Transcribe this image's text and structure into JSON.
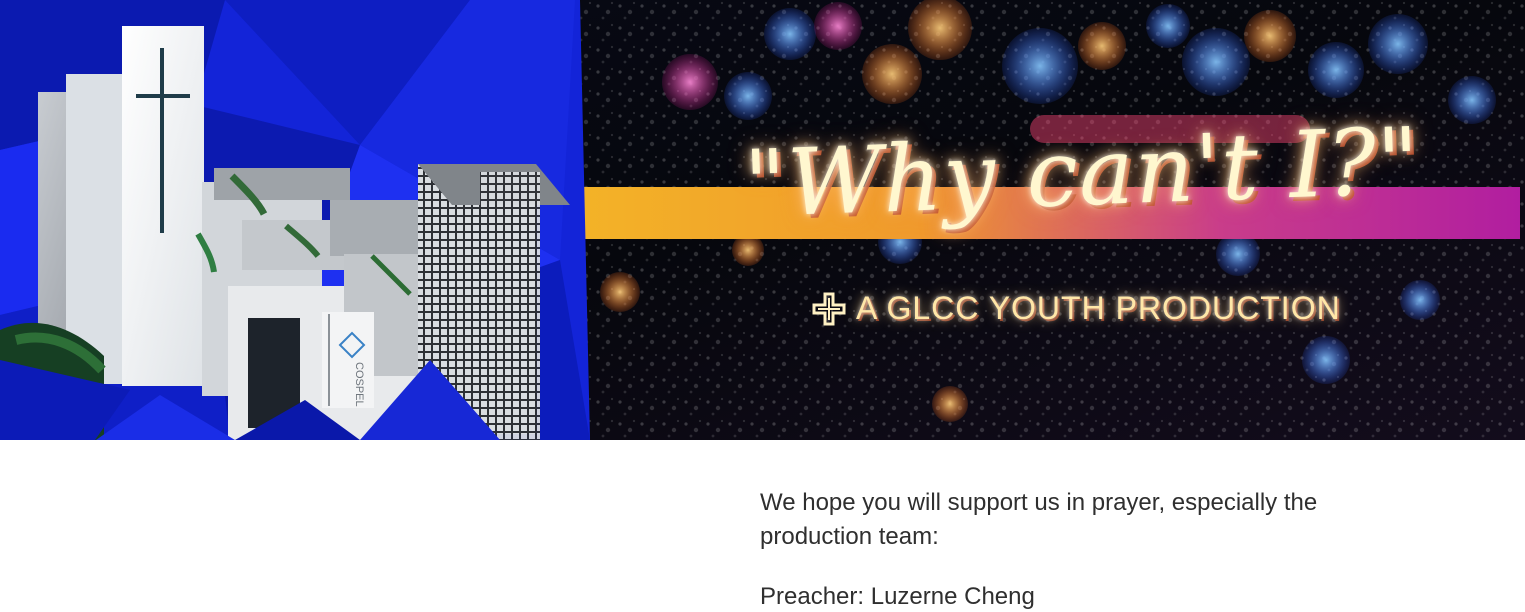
{
  "hero": {
    "title": "\"Why can't I?\"",
    "subtitle": "A GLCC YOUTH PRODUCTION",
    "building_sign": "COSPEL"
  },
  "content": {
    "intro": "We hope you will support us in prayer, especially the production team:",
    "preacher": "Preacher: Luzerne Cheng"
  },
  "icons": {
    "logo": "cross-icon"
  },
  "colors": {
    "blue": "#1324d8",
    "banner_yellow": "#f2b52d",
    "banner_pink": "#d33aa0",
    "text": "#2f2f2f"
  }
}
